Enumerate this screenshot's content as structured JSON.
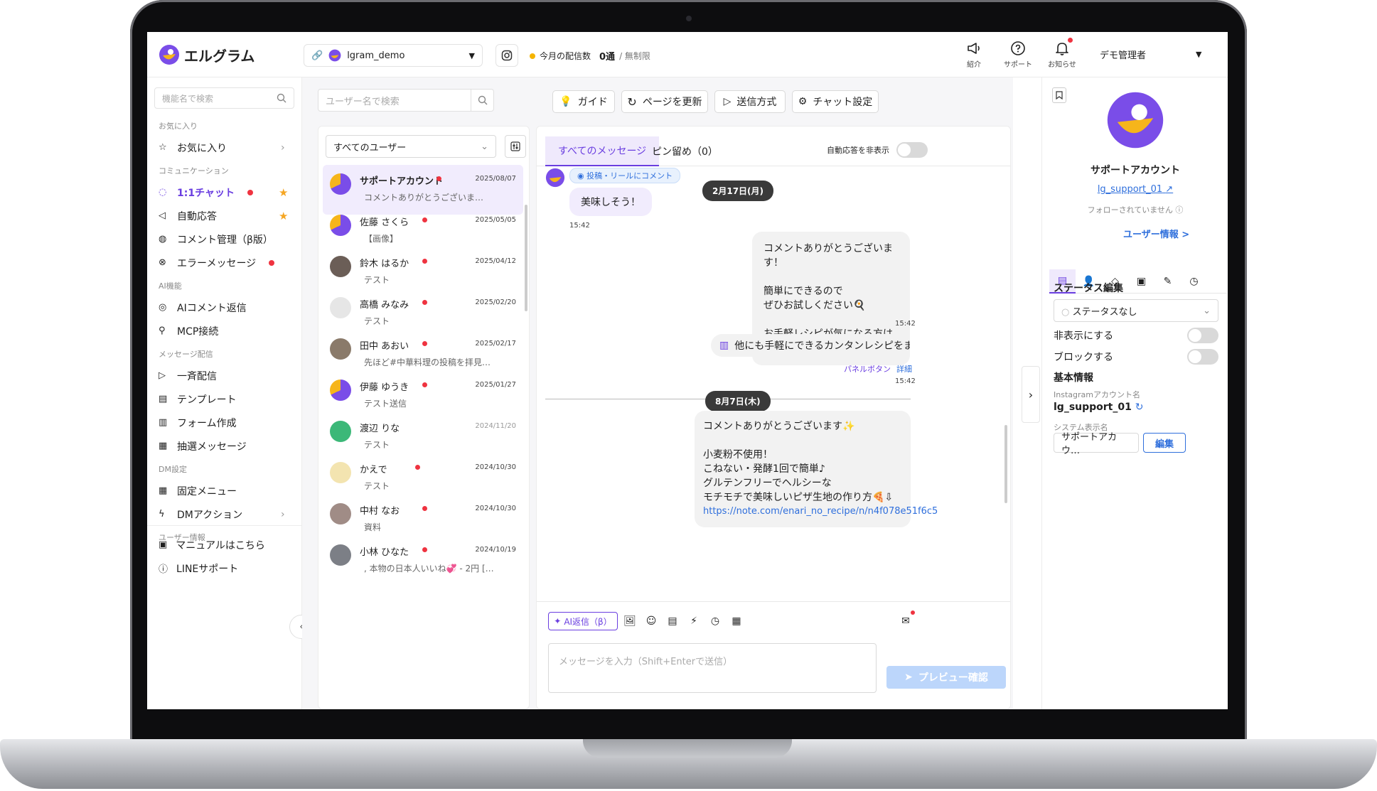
{
  "app": {
    "logo_text": "エルグラム"
  },
  "header": {
    "account_name": "lgram_demo",
    "quota_label": "今月の配信数",
    "quota_value": "0通",
    "quota_limit": "/ 無制限",
    "icons": [
      {
        "icon": "megaphone-icon",
        "label": "紹介"
      },
      {
        "icon": "help-circle-icon",
        "label": "サポート"
      },
      {
        "icon": "bell-icon",
        "label": "お知らせ"
      }
    ],
    "admin_name": "デモ管理者"
  },
  "sidebar": {
    "search_placeholder": "機能名で検索",
    "sections": [
      {
        "title": "お気に入り",
        "items": [
          {
            "label": "お気に入り",
            "icon": "star-outline-icon",
            "chevron": true
          }
        ]
      },
      {
        "title": "コミュニケーション",
        "items": [
          {
            "label": "1:1チャット",
            "icon": "chat-icon",
            "active": true,
            "dot": true,
            "star": true
          },
          {
            "label": "自動応答",
            "icon": "megaphone-icon",
            "star": true
          },
          {
            "label": "コメント管理（β版）",
            "icon": "comment-icon"
          },
          {
            "label": "エラーメッセージ",
            "icon": "error-icon",
            "dot": true
          }
        ]
      },
      {
        "title": "AI機能",
        "items": [
          {
            "label": "AIコメント返信",
            "icon": "ai-comment-icon"
          },
          {
            "label": "MCP接続",
            "icon": "plug-icon"
          }
        ]
      },
      {
        "title": "メッセージ配信",
        "items": [
          {
            "label": "一斉配信",
            "icon": "send-icon"
          },
          {
            "label": "テンプレート",
            "icon": "template-icon"
          },
          {
            "label": "フォーム作成",
            "icon": "form-icon"
          },
          {
            "label": "抽選メッセージ",
            "icon": "gift-icon"
          }
        ]
      },
      {
        "title": "DM設定",
        "items": [
          {
            "label": "固定メニュー",
            "icon": "grid-icon"
          },
          {
            "label": "DMアクション",
            "icon": "bolt-icon",
            "chevron": true
          }
        ]
      },
      {
        "title": "ユーザー情報",
        "items": []
      }
    ],
    "footer": [
      {
        "label": "マニュアルはこちら",
        "icon": "book-icon"
      },
      {
        "label": "LINEサポート",
        "icon": "help-circle-icon"
      }
    ]
  },
  "toolbar": {
    "user_search_placeholder": "ユーザー名で検索",
    "buttons": [
      {
        "label": "ガイド",
        "icon": "lightbulb-icon"
      },
      {
        "label": "ページを更新",
        "icon": "refresh-icon"
      },
      {
        "label": "送信方式",
        "icon": "send-icon"
      },
      {
        "label": "チャット設定",
        "icon": "gear-icon"
      }
    ]
  },
  "conversations": {
    "filter_value": "すべてのユーザー",
    "items": [
      {
        "name": "サポートアカウント",
        "date": "2025/08/07",
        "preview": "コメントありがとうございま…",
        "unread": true,
        "selected": true,
        "avatar": "brand",
        "date_gray": false
      },
      {
        "name": "佐藤 さくら",
        "date": "2025/05/05",
        "preview": "【画像】",
        "unread": true,
        "avatar": "brand",
        "date_gray": false
      },
      {
        "name": "鈴木 はるか",
        "date": "2025/04/12",
        "preview": "テスト",
        "unread": true,
        "avatar": "photo1",
        "date_gray": false
      },
      {
        "name": "高橋 みなみ",
        "date": "2025/02/20",
        "preview": "テスト",
        "unread": true,
        "avatar": "placeholder",
        "date_gray": false
      },
      {
        "name": "田中 あおい",
        "date": "2025/02/17",
        "preview": "先ほど#中華料理の投稿を拝見…",
        "unread": true,
        "avatar": "photo2",
        "date_gray": false
      },
      {
        "name": "伊藤 ゆうき",
        "date": "2025/01/27",
        "preview": "テスト送信",
        "unread": true,
        "avatar": "brand",
        "date_gray": false
      },
      {
        "name": "渡辺 りな",
        "date": "2024/11/20",
        "preview": "テスト",
        "unread": false,
        "avatar": "green",
        "date_gray": true
      },
      {
        "name": "かえで",
        "date": "2024/10/30",
        "preview": "テスト",
        "unread": true,
        "avatar": "illust",
        "date_gray": false
      },
      {
        "name": "中村 なお",
        "date": "2024/10/30",
        "preview": "資料",
        "unread": true,
        "avatar": "photo3",
        "date_gray": false
      },
      {
        "name": "小林 ひなた",
        "date": "2024/10/19",
        "preview": ", 本物の日本人いいね💞 - 2円 […",
        "unread": true,
        "avatar": "photo4",
        "date_gray": false
      }
    ]
  },
  "chat": {
    "tab_all": "すべてのメッセージ",
    "tab_pinned": "ピン留め（0）",
    "hide_auto_label": "自動応答を非表示",
    "comment_badge": "投稿・リールにコメント",
    "date1": "2月17日(月)",
    "incoming_text": "美味しそう！",
    "incoming_time": "15:42",
    "reply1": "コメントありがとうございます！\n\n簡単にできるので\nぜひお試しください🍳\n\nお手軽レシピが気になる方はこちら↓",
    "reply1_time": "15:42",
    "panel_text": "他にも手軽にできるカンタンレシピをまと…",
    "panel_button_label": "パネルボタン",
    "panel_detail": "詳細",
    "panel_time": "15:42",
    "date2": "8月7日(木)",
    "reply2": "コメントありがとうございます✨\n\n小麦粉不使用！\nこねない・発酵1回で簡単♪\nグルテンフリーでヘルシーな\nモチモチで美味しいピザ生地の作り方🍕⇩",
    "reply2_link": "https://note.com/enari_no_recipe/n/n4f078e51f6c5",
    "ai_button": "AI返信（β）",
    "input_placeholder": "メッセージを入力（Shift+Enterで送信）",
    "preview_button": "プレビュー確認"
  },
  "profile": {
    "name": "サポートアカウント",
    "handle": "lg_support_01",
    "follow_status": "フォローされていません",
    "user_info_link": "ユーザー情報 >",
    "status_heading": "ステータス編集",
    "status_value": "ステータスなし",
    "hide_label": "非表示にする",
    "block_label": "ブロックする",
    "basic_heading": "基本情報",
    "ig_name_label": "Instagramアカウント名",
    "ig_name_value": "lg_support_01",
    "system_name_label": "システム表示名",
    "system_name_value": "サポートアカウ…",
    "edit_button": "編集"
  },
  "colors": {
    "accent": "#6a3ee0",
    "unread": "#ef3340",
    "link": "#2f6fdc",
    "brand_yellow": "#f6b51b"
  }
}
